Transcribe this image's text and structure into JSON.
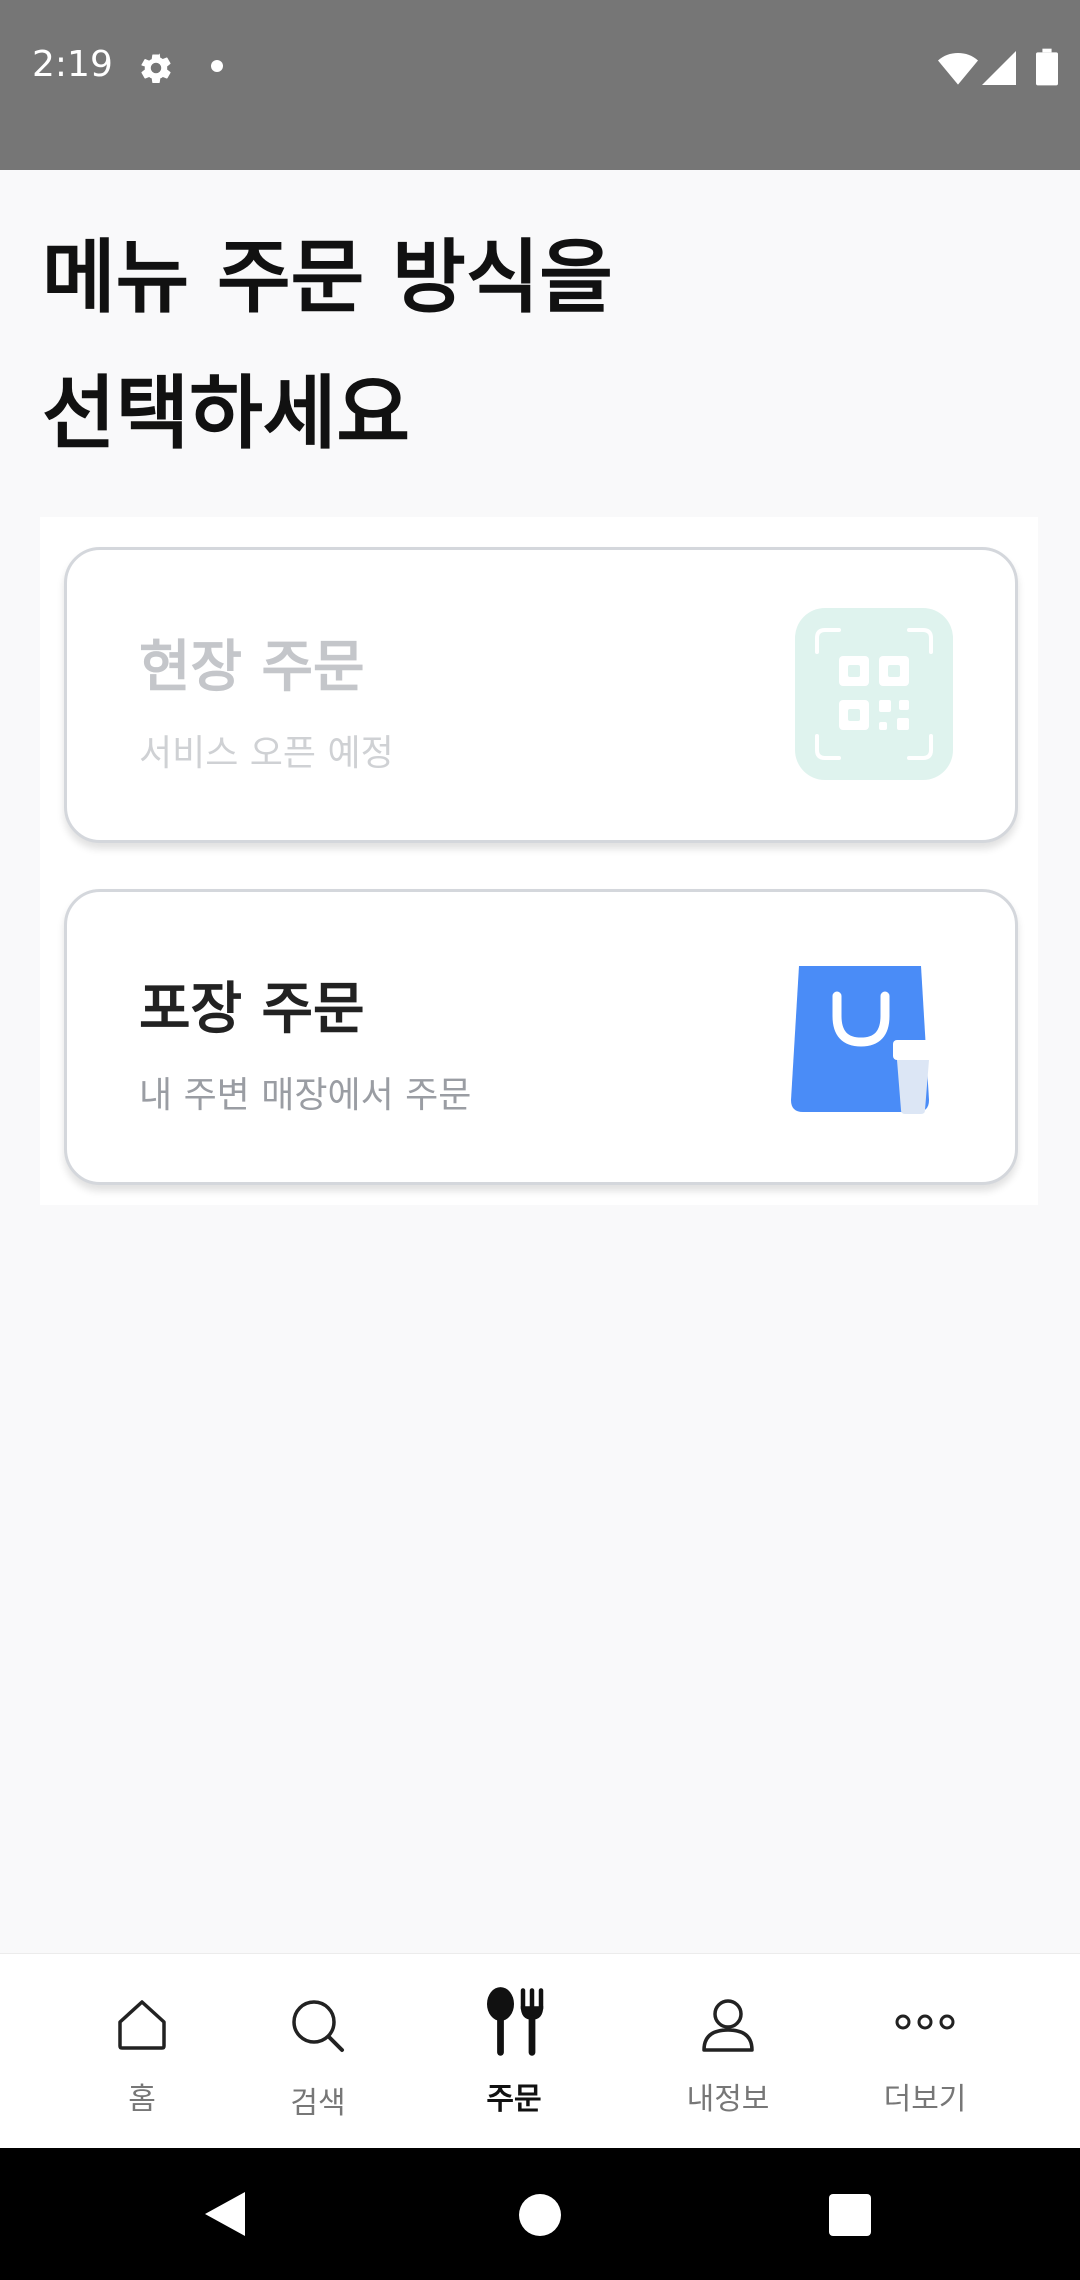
{
  "status_bar": {
    "time": "2:19"
  },
  "header": {
    "title_line1": "메뉴 주문 방식을",
    "title_line2": "선택하세요"
  },
  "options": [
    {
      "title": "현장 주문",
      "subtitle": "서비스 오픈 예정",
      "icon": "qr-code-icon",
      "enabled": false
    },
    {
      "title": "포장 주문",
      "subtitle": "내 주변 매장에서 주문",
      "icon": "shopping-bag-icon",
      "enabled": true
    }
  ],
  "bottom_nav": {
    "items": [
      {
        "label": "홈",
        "icon": "home-icon"
      },
      {
        "label": "검색",
        "icon": "search-icon"
      },
      {
        "label": "주문",
        "icon": "fork-spoon-icon",
        "active": true
      },
      {
        "label": "내정보",
        "icon": "person-icon"
      },
      {
        "label": "더보기",
        "icon": "more-dots-icon"
      }
    ]
  },
  "colors": {
    "accent_blue": "#4a8cf7",
    "qr_mint": "#dff3ee",
    "status_bar": "#767676"
  }
}
